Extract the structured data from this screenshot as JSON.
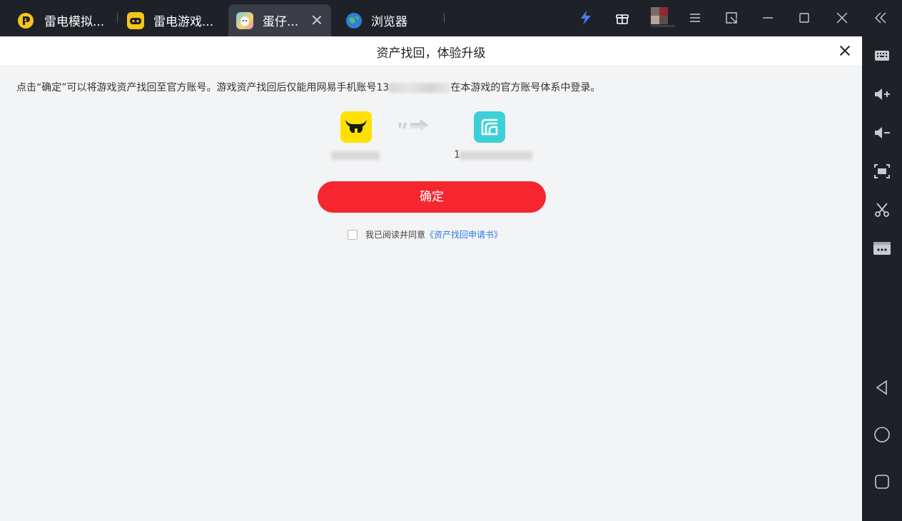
{
  "tabs": [
    {
      "label": "雷电模拟...",
      "icon": "ldplayer-logo-icon",
      "color": "#f5c518",
      "active": false
    },
    {
      "label": "雷电游戏...",
      "icon": "gamepad-icon",
      "color": "#f5c518",
      "active": false
    },
    {
      "label": "蛋仔...",
      "icon": "eggy-party-icon",
      "active": true
    },
    {
      "label": "浏览器",
      "icon": "globe-icon",
      "active": false
    }
  ],
  "toolbar": {
    "accent": "#4a7cf5",
    "buttons": [
      "speed-icon",
      "gift-box-icon",
      "avatar",
      "menu-icon",
      "window-mode-icon",
      "minimize-icon",
      "maximize-icon",
      "close-icon",
      "collapse-sidebar-icon"
    ]
  },
  "sidebar": {
    "buttons": [
      "keyboard-icon",
      "volume-up-icon",
      "volume-down-icon",
      "screenshot-icon",
      "scissors-icon",
      "more-icon",
      "back-icon",
      "home-icon",
      "recent-apps-icon"
    ]
  },
  "dialog": {
    "title": "资产找回，体验升级",
    "desc_before": "点击“确定”可以将游戏资产找回至官方账号。游戏资产找回后仅能用网易手机账号13",
    "desc_after": "在本游戏的官方账号体系中登录。",
    "from_app_color": "#ffe100",
    "to_app_color": "#3ed0d8",
    "to_account_prefix": "1",
    "confirm_label": "确定",
    "agree_text": "我已阅读并同意",
    "agree_link": "《资产找回申请书》",
    "confirm_color": "#f5262e",
    "link_color": "#2e7be6"
  }
}
